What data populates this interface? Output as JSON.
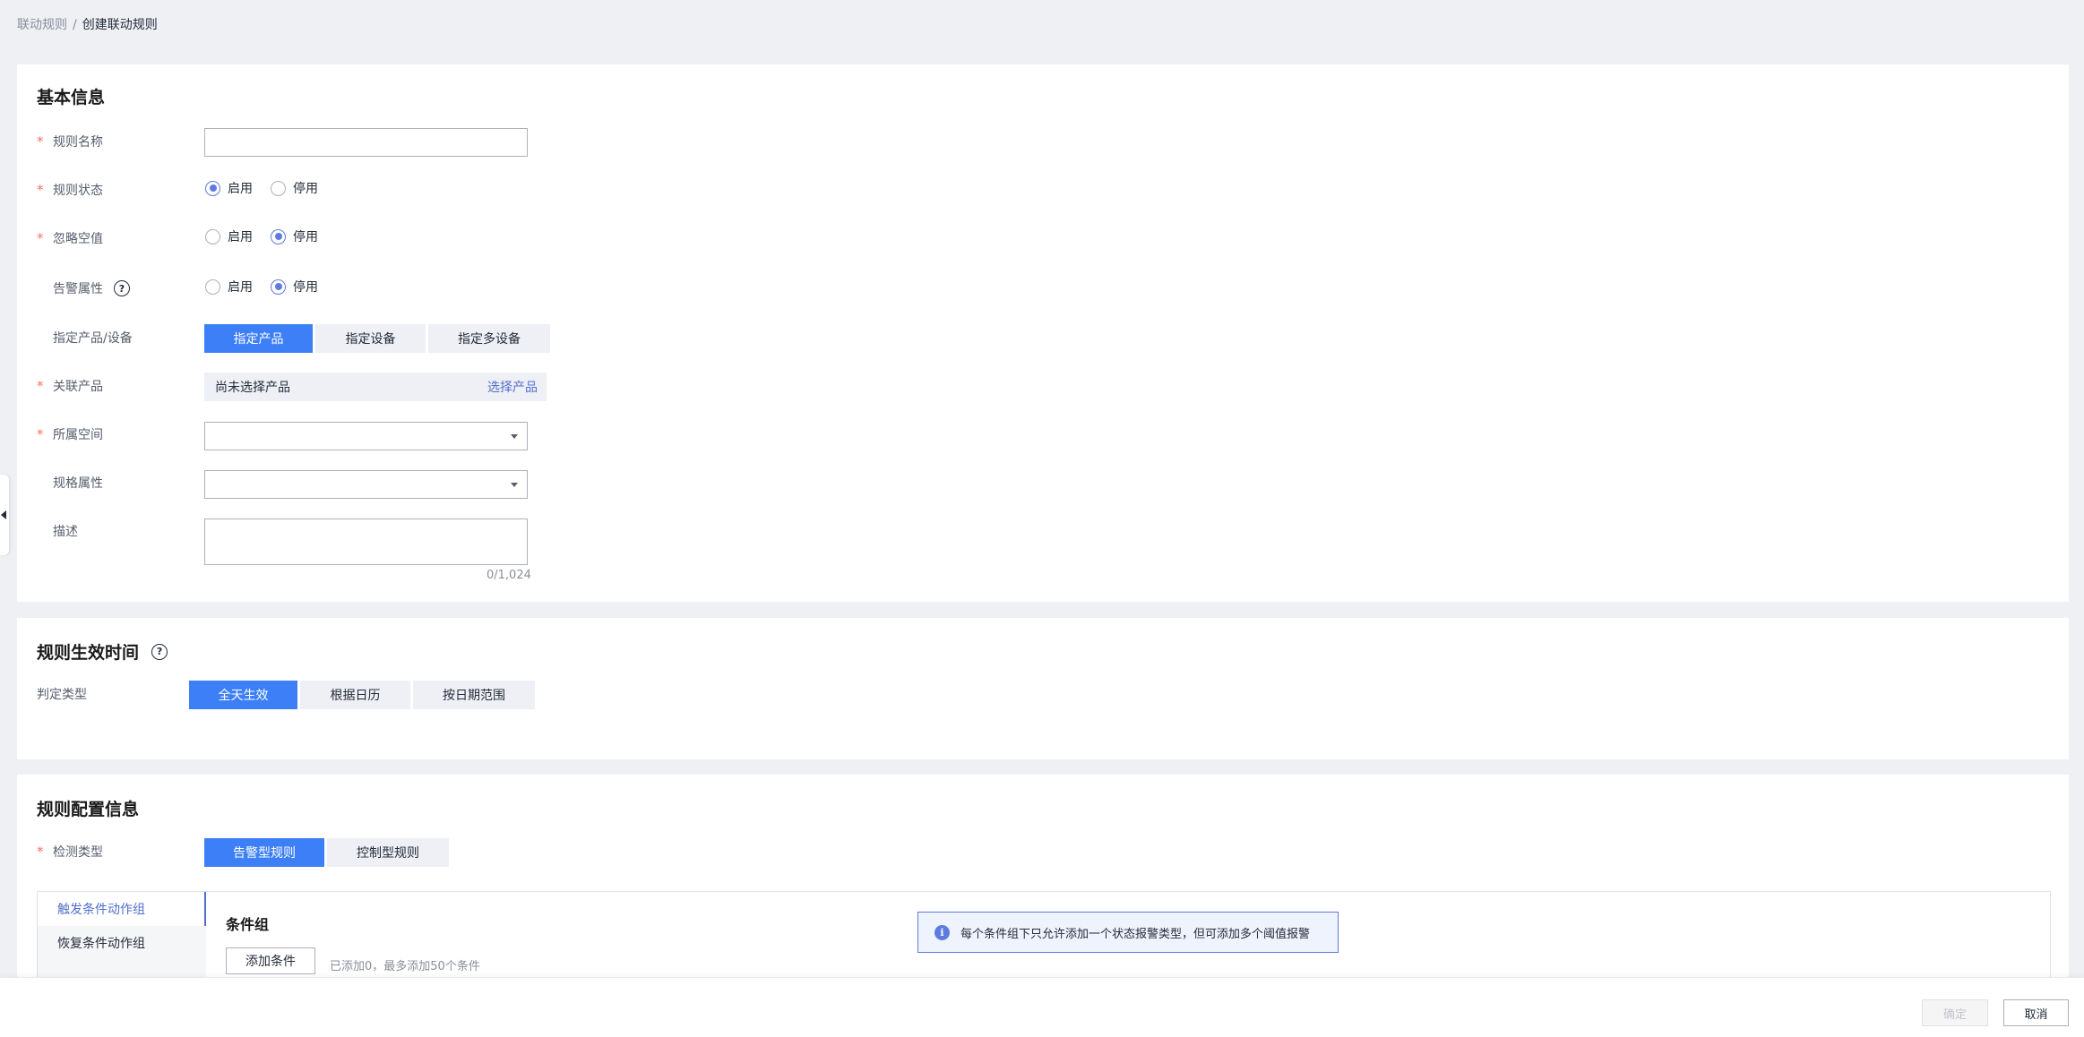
{
  "breadcrumb": {
    "parent": "联动规则",
    "separator": "/",
    "current": "创建联动规则"
  },
  "basic": {
    "title": "基本信息",
    "rule_name": {
      "label": "规则名称",
      "value": "",
      "placeholder": ""
    },
    "rule_status": {
      "label": "规则状态",
      "options": [
        "启用",
        "停用"
      ],
      "selected": "启用"
    },
    "ignore_null": {
      "label": "忽略空值",
      "options": [
        "启用",
        "停用"
      ],
      "selected": "停用"
    },
    "alarm_attr": {
      "label": "告警属性",
      "options": [
        "启用",
        "停用"
      ],
      "selected": "停用"
    },
    "target": {
      "label": "指定产品/设备",
      "options": [
        "指定产品",
        "指定设备",
        "指定多设备"
      ],
      "selected": "指定产品"
    },
    "product": {
      "label": "关联产品",
      "empty_text": "尚未选择产品",
      "link": "选择产品"
    },
    "space": {
      "label": "所属空间",
      "value": ""
    },
    "spec_attr": {
      "label": "规格属性",
      "value": ""
    },
    "description": {
      "label": "描述",
      "value": "",
      "counter": "0/1,024"
    }
  },
  "effective_time": {
    "title": "规则生效时间",
    "judge_type": {
      "label": "判定类型",
      "options": [
        "全天生效",
        "根据日历",
        "按日期范围"
      ],
      "selected": "全天生效"
    }
  },
  "config": {
    "title": "规则配置信息",
    "detect_type": {
      "label": "检测类型",
      "options": [
        "告警型规则",
        "控制型规则"
      ],
      "selected": "告警型规则"
    },
    "side_tabs": [
      "触发条件动作组",
      "恢复条件动作组"
    ],
    "active_side_tab": "触发条件动作组",
    "condition_group": {
      "title": "条件组",
      "add_button": "添加条件",
      "hint": "已添加0，最多添加50个条件",
      "info": "每个条件组下只允许添加一个状态报警类型，但可添加多个阈值报警"
    }
  },
  "footer": {
    "confirm": "确定",
    "cancel": "取消"
  },
  "colors": {
    "primary": "#3d7ff7",
    "link": "#526ecc",
    "required": "#f66f6a",
    "radio": "#5e7ce0"
  }
}
